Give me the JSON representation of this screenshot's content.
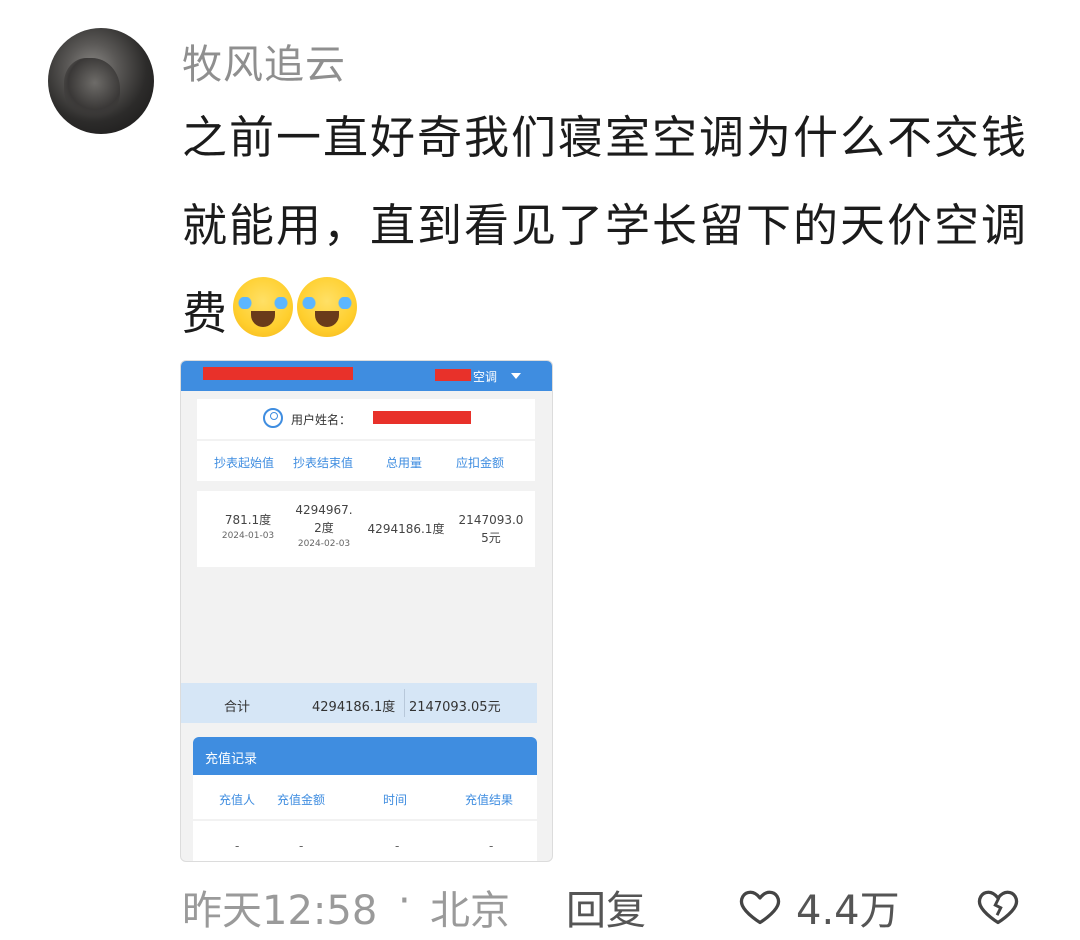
{
  "comment": {
    "username": "牧风追云",
    "text": "之前一直好奇我们寝室空调为什么不交钱就能用，直到看见了学长留下的天价空调费",
    "emojis": [
      "crying-laughing-face",
      "crying-laughing-face"
    ],
    "footer": {
      "time": "昨天12:58",
      "separator": "·",
      "location": "北京",
      "reply_label": "回复",
      "like_count": "4.4万"
    }
  },
  "screenshot": {
    "header_label": "空调",
    "user_label": "用户姓名：",
    "columns": [
      "抄表起始值",
      "抄表结束值",
      "总用量",
      "应扣金额"
    ],
    "row": {
      "start_value": "781.1度",
      "start_date": "2024-01-03",
      "end_value": "4294967.2度",
      "end_date": "2024-02-03",
      "usage": "4294186.1度",
      "amount": "2147093.05元"
    },
    "total": {
      "label": "合计",
      "usage": "4294186.1度",
      "amount": "2147093.05元"
    },
    "recharge": {
      "title": "充值记录",
      "columns": [
        "充值人",
        "充值金额",
        "时间",
        "充值结果"
      ],
      "values": [
        "-",
        "-",
        "-",
        "-"
      ]
    },
    "colors": {
      "header": "#3f8de0",
      "redaction": "#e8312a",
      "total_bg": "#d6e6f6"
    }
  }
}
